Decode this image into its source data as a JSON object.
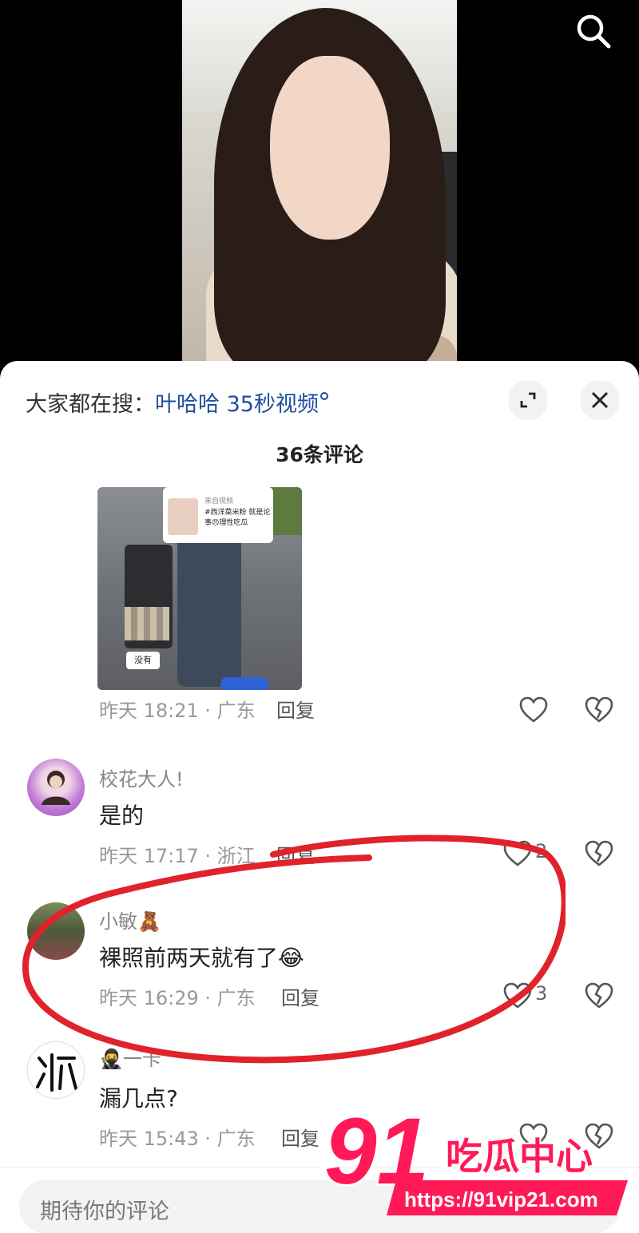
{
  "topbar": {
    "suggest_prefix": "大家都在搜：",
    "suggest_keyword": "叶哈哈 35秒视频"
  },
  "header": {
    "comment_count": "36条评论"
  },
  "comments": [
    {
      "image_card": {
        "source_label": "来自视频",
        "caption": "#西洋菜米粉 就是论事😠理性吃瓜",
        "bubble": "没有"
      },
      "time_loc": "昨天 18:21 · 广东",
      "reply": "回复",
      "likes": ""
    },
    {
      "username": "校花大人!",
      "text": "是的",
      "time_loc": "昨天 17:17 · 浙江",
      "reply": "回复",
      "likes": "2"
    },
    {
      "username": "小敏🧸",
      "text": "裸照前两天就有了😂",
      "time_loc": "昨天 16:29 · 广东",
      "reply": "回复",
      "likes": "3"
    },
    {
      "username": "🥷一卡",
      "text": "漏几点?",
      "time_loc": "昨天 15:43 · 广东",
      "reply": "回复",
      "likes": ""
    }
  ],
  "composer": {
    "placeholder": "期待你的评论"
  },
  "watermark": {
    "number": "91",
    "name": "吃瓜中心",
    "url": "https://91vip21.com"
  },
  "colors": {
    "keyword": "#1f4e9c",
    "annotation_circle": "#e0222a",
    "watermark_pink": "#ff1a57"
  }
}
